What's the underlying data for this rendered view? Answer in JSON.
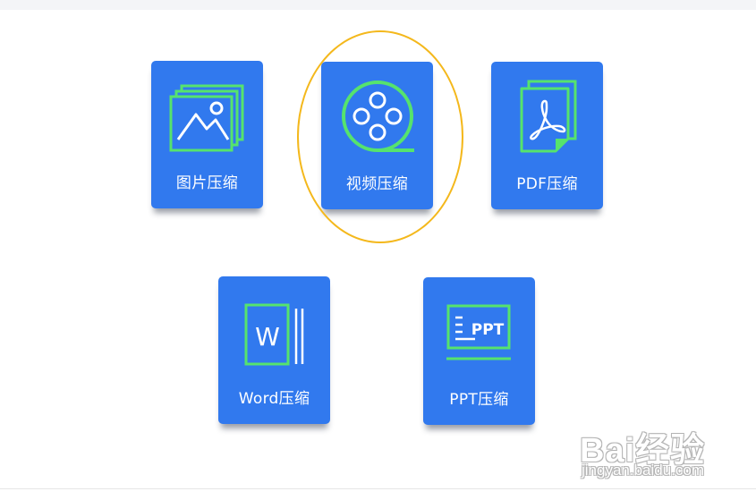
{
  "colors": {
    "card_background": "#3179ee",
    "icon_accent": "#56e36d",
    "icon_white": "#ffffff",
    "highlight_ring": "#f4b81c"
  },
  "tools": [
    {
      "id": "image",
      "label": "图片压缩",
      "icon": "image-stack-icon"
    },
    {
      "id": "video",
      "label": "视频压缩",
      "icon": "film-reel-icon",
      "highlighted": true
    },
    {
      "id": "pdf",
      "label": "PDF压缩",
      "icon": "pdf-document-icon"
    },
    {
      "id": "word",
      "label": "Word压缩",
      "icon": "word-document-icon",
      "icon_text": "W"
    },
    {
      "id": "ppt",
      "label": "PPT压缩",
      "icon": "ppt-presentation-icon",
      "icon_text": "PPT"
    }
  ],
  "watermark": {
    "logo_text": "Bai经验",
    "url": "jingyan.baidu.com"
  }
}
